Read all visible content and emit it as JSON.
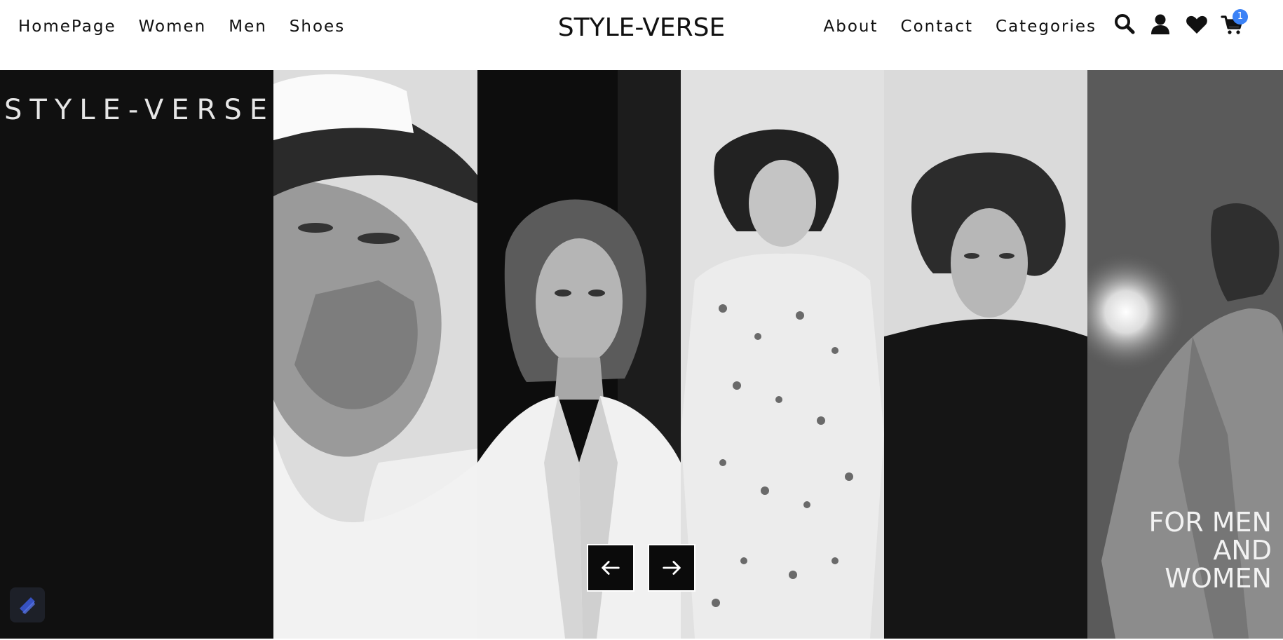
{
  "header": {
    "brand": "STYLE-VERSE",
    "left_links": [
      {
        "label": "HomePage"
      },
      {
        "label": "Women"
      },
      {
        "label": "Men"
      },
      {
        "label": "Shoes"
      }
    ],
    "right_links": [
      {
        "label": "About"
      },
      {
        "label": "Contact"
      },
      {
        "label": "Categories"
      }
    ],
    "icons": [
      "search-icon",
      "user-icon",
      "heart-icon",
      "cart-icon"
    ],
    "cart_count": "1"
  },
  "hero": {
    "title": "STYLE-VERSE",
    "tagline_lines": [
      "FOR MEN",
      "AND",
      "WOMEN"
    ],
    "prev_icon": "arrow-left-icon",
    "next_icon": "arrow-right-icon"
  },
  "colors": {
    "badge": "#3b82f6",
    "hero_bg": "#111111",
    "text": "#111111"
  }
}
